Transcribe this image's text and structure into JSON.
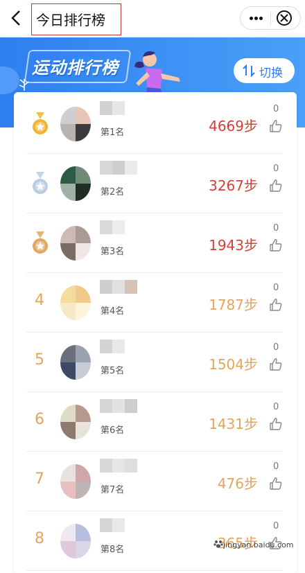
{
  "nav": {
    "title": "今日排行榜",
    "back_icon": "chevron-left-icon",
    "more_icon": "more-dots-icon",
    "close_icon": "close-circle-icon"
  },
  "banner": {
    "title": "运动排行榜",
    "switch_label": "切换",
    "switch_icon": "swap-arrows-icon",
    "accent_color": "#2f7ff0"
  },
  "colors": {
    "top3_steps": "#d23f36",
    "other_steps": "#e3a45c",
    "gold_medal": "#f1b330",
    "silver_medal": "#b9cde0",
    "bronze_medal": "#e0a864"
  },
  "ranking": [
    {
      "rank": "1",
      "medal": "gold",
      "place": "第1名",
      "steps": "4669步",
      "likes": "0"
    },
    {
      "rank": "2",
      "medal": "silver",
      "place": "第2名",
      "steps": "3267步",
      "likes": "0"
    },
    {
      "rank": "3",
      "medal": "bronze",
      "place": "第3名",
      "steps": "1943步",
      "likes": "0"
    },
    {
      "rank": "4",
      "medal": "",
      "place": "第4名",
      "steps": "1787步",
      "likes": "0"
    },
    {
      "rank": "5",
      "medal": "",
      "place": "第5名",
      "steps": "1504步",
      "likes": "0"
    },
    {
      "rank": "6",
      "medal": "",
      "place": "第6名",
      "steps": "1431步",
      "likes": "0"
    },
    {
      "rank": "7",
      "medal": "",
      "place": "第7名",
      "steps": "476步",
      "likes": "0"
    },
    {
      "rank": "8",
      "medal": "",
      "place": "第8名",
      "steps": "365步",
      "likes": "0"
    }
  ],
  "watermark": "jingyan.baidu.com"
}
